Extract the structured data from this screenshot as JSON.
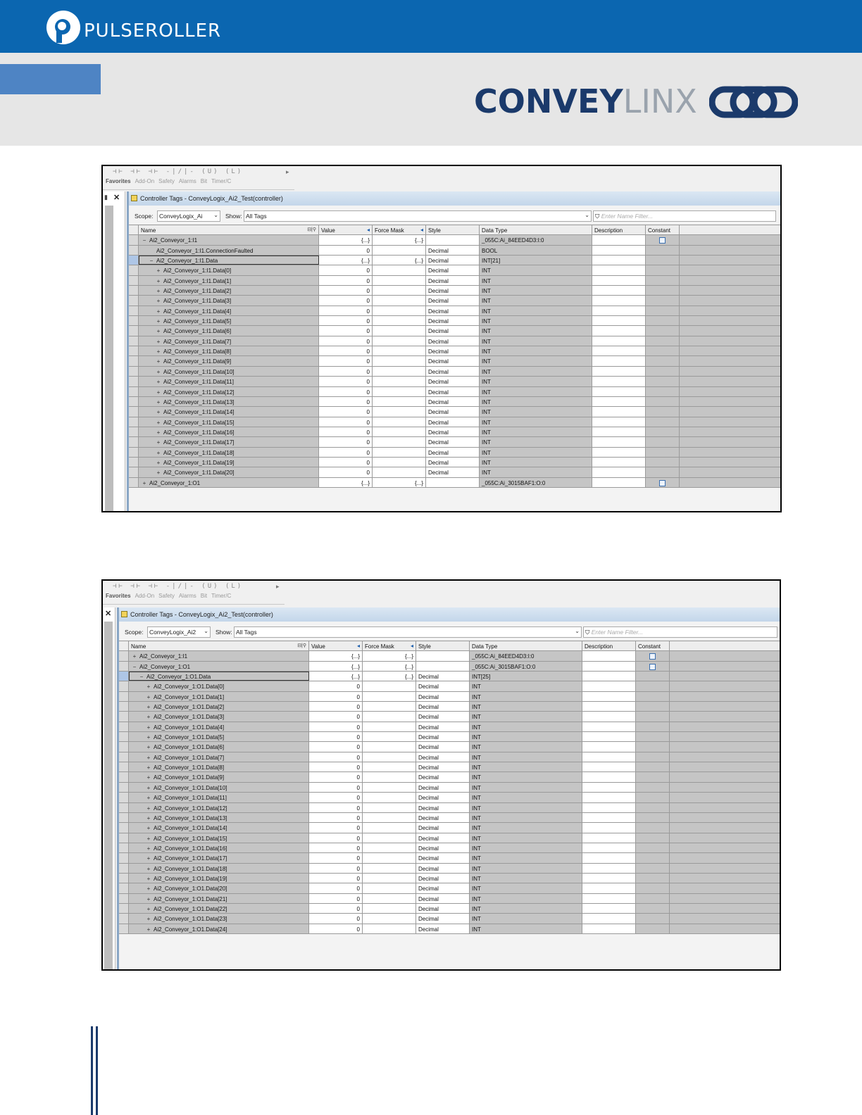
{
  "header": {
    "brand": "PULSEROLLER",
    "product_bold": "CONVEY",
    "product_light": "LINX"
  },
  "colors": {
    "header_blue": "#0b66b0",
    "band_gray": "#e6e6e6",
    "convey_navy": "#1b3a6b",
    "selection_blue": "#aec6e6"
  },
  "toolbar": {
    "tabs": [
      "Favorites",
      "Add-On",
      "Safety",
      "Alarms",
      "Bit",
      "Timer/C"
    ]
  },
  "columns": [
    "Name",
    "Value",
    "Force Mask",
    "Style",
    "Data Type",
    "Description",
    "Constant"
  ],
  "screen1": {
    "window_title": "Controller Tags - ConveyLogix_Ai2_Test(controller)",
    "scope_label": "Scope:",
    "scope_value": "ConveyLogix_Ai",
    "show_label": "Show:",
    "show_value": "All Tags",
    "filter_placeholder": "Enter Name Filter...",
    "rows": [
      {
        "name": "Ai2_Conveyor_1:I1",
        "indent": 0,
        "expander": "−",
        "value": "{...}",
        "force": "{...}",
        "style": "",
        "type": "_055C:Ai_84EED4D3:I:0",
        "constant": true
      },
      {
        "name": "Ai2_Conveyor_1:I1.ConnectionFaulted",
        "indent": 1,
        "expander": "",
        "value": "0",
        "force": "",
        "style": "Decimal",
        "type": "BOOL",
        "constant": false
      },
      {
        "name": "Ai2_Conveyor_1:I1.Data",
        "indent": 1,
        "expander": "−",
        "value": "{...}",
        "force": "{...}",
        "style": "Decimal",
        "type": "INT[21]",
        "constant": false,
        "focus": true
      },
      {
        "name": "Ai2_Conveyor_1:I1.Data[0]",
        "indent": 2,
        "expander": "+",
        "value": "0",
        "force": "",
        "style": "Decimal",
        "type": "INT",
        "constant": false
      },
      {
        "name": "Ai2_Conveyor_1:I1.Data[1]",
        "indent": 2,
        "expander": "+",
        "value": "0",
        "force": "",
        "style": "Decimal",
        "type": "INT",
        "constant": false
      },
      {
        "name": "Ai2_Conveyor_1:I1.Data[2]",
        "indent": 2,
        "expander": "+",
        "value": "0",
        "force": "",
        "style": "Decimal",
        "type": "INT",
        "constant": false
      },
      {
        "name": "Ai2_Conveyor_1:I1.Data[3]",
        "indent": 2,
        "expander": "+",
        "value": "0",
        "force": "",
        "style": "Decimal",
        "type": "INT",
        "constant": false
      },
      {
        "name": "Ai2_Conveyor_1:I1.Data[4]",
        "indent": 2,
        "expander": "+",
        "value": "0",
        "force": "",
        "style": "Decimal",
        "type": "INT",
        "constant": false
      },
      {
        "name": "Ai2_Conveyor_1:I1.Data[5]",
        "indent": 2,
        "expander": "+",
        "value": "0",
        "force": "",
        "style": "Decimal",
        "type": "INT",
        "constant": false
      },
      {
        "name": "Ai2_Conveyor_1:I1.Data[6]",
        "indent": 2,
        "expander": "+",
        "value": "0",
        "force": "",
        "style": "Decimal",
        "type": "INT",
        "constant": false
      },
      {
        "name": "Ai2_Conveyor_1:I1.Data[7]",
        "indent": 2,
        "expander": "+",
        "value": "0",
        "force": "",
        "style": "Decimal",
        "type": "INT",
        "constant": false
      },
      {
        "name": "Ai2_Conveyor_1:I1.Data[8]",
        "indent": 2,
        "expander": "+",
        "value": "0",
        "force": "",
        "style": "Decimal",
        "type": "INT",
        "constant": false
      },
      {
        "name": "Ai2_Conveyor_1:I1.Data[9]",
        "indent": 2,
        "expander": "+",
        "value": "0",
        "force": "",
        "style": "Decimal",
        "type": "INT",
        "constant": false
      },
      {
        "name": "Ai2_Conveyor_1:I1.Data[10]",
        "indent": 2,
        "expander": "+",
        "value": "0",
        "force": "",
        "style": "Decimal",
        "type": "INT",
        "constant": false
      },
      {
        "name": "Ai2_Conveyor_1:I1.Data[11]",
        "indent": 2,
        "expander": "+",
        "value": "0",
        "force": "",
        "style": "Decimal",
        "type": "INT",
        "constant": false
      },
      {
        "name": "Ai2_Conveyor_1:I1.Data[12]",
        "indent": 2,
        "expander": "+",
        "value": "0",
        "force": "",
        "style": "Decimal",
        "type": "INT",
        "constant": false
      },
      {
        "name": "Ai2_Conveyor_1:I1.Data[13]",
        "indent": 2,
        "expander": "+",
        "value": "0",
        "force": "",
        "style": "Decimal",
        "type": "INT",
        "constant": false
      },
      {
        "name": "Ai2_Conveyor_1:I1.Data[14]",
        "indent": 2,
        "expander": "+",
        "value": "0",
        "force": "",
        "style": "Decimal",
        "type": "INT",
        "constant": false
      },
      {
        "name": "Ai2_Conveyor_1:I1.Data[15]",
        "indent": 2,
        "expander": "+",
        "value": "0",
        "force": "",
        "style": "Decimal",
        "type": "INT",
        "constant": false
      },
      {
        "name": "Ai2_Conveyor_1:I1.Data[16]",
        "indent": 2,
        "expander": "+",
        "value": "0",
        "force": "",
        "style": "Decimal",
        "type": "INT",
        "constant": false
      },
      {
        "name": "Ai2_Conveyor_1:I1.Data[17]",
        "indent": 2,
        "expander": "+",
        "value": "0",
        "force": "",
        "style": "Decimal",
        "type": "INT",
        "constant": false
      },
      {
        "name": "Ai2_Conveyor_1:I1.Data[18]",
        "indent": 2,
        "expander": "+",
        "value": "0",
        "force": "",
        "style": "Decimal",
        "type": "INT",
        "constant": false
      },
      {
        "name": "Ai2_Conveyor_1:I1.Data[19]",
        "indent": 2,
        "expander": "+",
        "value": "0",
        "force": "",
        "style": "Decimal",
        "type": "INT",
        "constant": false
      },
      {
        "name": "Ai2_Conveyor_1:I1.Data[20]",
        "indent": 2,
        "expander": "+",
        "value": "0",
        "force": "",
        "style": "Decimal",
        "type": "INT",
        "constant": false
      },
      {
        "name": "Ai2_Conveyor_1:O1",
        "indent": 0,
        "expander": "+",
        "value": "{...}",
        "force": "{...}",
        "style": "",
        "type": "_055C:Ai_3015BAF1:O:0",
        "constant": true
      }
    ]
  },
  "screen2": {
    "window_title": "Controller Tags - ConveyLogix_Ai2_Test(controller)",
    "scope_label": "Scope:",
    "scope_value": "ConveyLogix_Ai2",
    "show_label": "Show:",
    "show_value": "All Tags",
    "filter_placeholder": "Enter Name Filter...",
    "rows": [
      {
        "name": "Ai2_Conveyor_1:I1",
        "indent": 0,
        "expander": "+",
        "value": "{...}",
        "force": "{...}",
        "style": "",
        "type": "_055C:Ai_84EED4D3:I:0",
        "constant": true
      },
      {
        "name": "Ai2_Conveyor_1:O1",
        "indent": 0,
        "expander": "−",
        "value": "{...}",
        "force": "{...}",
        "style": "",
        "type": "_055C:Ai_3015BAF1:O:0",
        "constant": true
      },
      {
        "name": "Ai2_Conveyor_1:O1.Data",
        "indent": 1,
        "expander": "−",
        "value": "{...}",
        "force": "{...}",
        "style": "Decimal",
        "type": "INT[25]",
        "constant": false,
        "focus": true
      },
      {
        "name": "Ai2_Conveyor_1:O1.Data[0]",
        "indent": 2,
        "expander": "+",
        "value": "0",
        "force": "",
        "style": "Decimal",
        "type": "INT",
        "constant": false
      },
      {
        "name": "Ai2_Conveyor_1:O1.Data[1]",
        "indent": 2,
        "expander": "+",
        "value": "0",
        "force": "",
        "style": "Decimal",
        "type": "INT",
        "constant": false
      },
      {
        "name": "Ai2_Conveyor_1:O1.Data[2]",
        "indent": 2,
        "expander": "+",
        "value": "0",
        "force": "",
        "style": "Decimal",
        "type": "INT",
        "constant": false
      },
      {
        "name": "Ai2_Conveyor_1:O1.Data[3]",
        "indent": 2,
        "expander": "+",
        "value": "0",
        "force": "",
        "style": "Decimal",
        "type": "INT",
        "constant": false
      },
      {
        "name": "Ai2_Conveyor_1:O1.Data[4]",
        "indent": 2,
        "expander": "+",
        "value": "0",
        "force": "",
        "style": "Decimal",
        "type": "INT",
        "constant": false
      },
      {
        "name": "Ai2_Conveyor_1:O1.Data[5]",
        "indent": 2,
        "expander": "+",
        "value": "0",
        "force": "",
        "style": "Decimal",
        "type": "INT",
        "constant": false
      },
      {
        "name": "Ai2_Conveyor_1:O1.Data[6]",
        "indent": 2,
        "expander": "+",
        "value": "0",
        "force": "",
        "style": "Decimal",
        "type": "INT",
        "constant": false
      },
      {
        "name": "Ai2_Conveyor_1:O1.Data[7]",
        "indent": 2,
        "expander": "+",
        "value": "0",
        "force": "",
        "style": "Decimal",
        "type": "INT",
        "constant": false
      },
      {
        "name": "Ai2_Conveyor_1:O1.Data[8]",
        "indent": 2,
        "expander": "+",
        "value": "0",
        "force": "",
        "style": "Decimal",
        "type": "INT",
        "constant": false
      },
      {
        "name": "Ai2_Conveyor_1:O1.Data[9]",
        "indent": 2,
        "expander": "+",
        "value": "0",
        "force": "",
        "style": "Decimal",
        "type": "INT",
        "constant": false
      },
      {
        "name": "Ai2_Conveyor_1:O1.Data[10]",
        "indent": 2,
        "expander": "+",
        "value": "0",
        "force": "",
        "style": "Decimal",
        "type": "INT",
        "constant": false
      },
      {
        "name": "Ai2_Conveyor_1:O1.Data[11]",
        "indent": 2,
        "expander": "+",
        "value": "0",
        "force": "",
        "style": "Decimal",
        "type": "INT",
        "constant": false
      },
      {
        "name": "Ai2_Conveyor_1:O1.Data[12]",
        "indent": 2,
        "expander": "+",
        "value": "0",
        "force": "",
        "style": "Decimal",
        "type": "INT",
        "constant": false
      },
      {
        "name": "Ai2_Conveyor_1:O1.Data[13]",
        "indent": 2,
        "expander": "+",
        "value": "0",
        "force": "",
        "style": "Decimal",
        "type": "INT",
        "constant": false
      },
      {
        "name": "Ai2_Conveyor_1:O1.Data[14]",
        "indent": 2,
        "expander": "+",
        "value": "0",
        "force": "",
        "style": "Decimal",
        "type": "INT",
        "constant": false
      },
      {
        "name": "Ai2_Conveyor_1:O1.Data[15]",
        "indent": 2,
        "expander": "+",
        "value": "0",
        "force": "",
        "style": "Decimal",
        "type": "INT",
        "constant": false
      },
      {
        "name": "Ai2_Conveyor_1:O1.Data[16]",
        "indent": 2,
        "expander": "+",
        "value": "0",
        "force": "",
        "style": "Decimal",
        "type": "INT",
        "constant": false
      },
      {
        "name": "Ai2_Conveyor_1:O1.Data[17]",
        "indent": 2,
        "expander": "+",
        "value": "0",
        "force": "",
        "style": "Decimal",
        "type": "INT",
        "constant": false
      },
      {
        "name": "Ai2_Conveyor_1:O1.Data[18]",
        "indent": 2,
        "expander": "+",
        "value": "0",
        "force": "",
        "style": "Decimal",
        "type": "INT",
        "constant": false
      },
      {
        "name": "Ai2_Conveyor_1:O1.Data[19]",
        "indent": 2,
        "expander": "+",
        "value": "0",
        "force": "",
        "style": "Decimal",
        "type": "INT",
        "constant": false
      },
      {
        "name": "Ai2_Conveyor_1:O1.Data[20]",
        "indent": 2,
        "expander": "+",
        "value": "0",
        "force": "",
        "style": "Decimal",
        "type": "INT",
        "constant": false
      },
      {
        "name": "Ai2_Conveyor_1:O1.Data[21]",
        "indent": 2,
        "expander": "+",
        "value": "0",
        "force": "",
        "style": "Decimal",
        "type": "INT",
        "constant": false
      },
      {
        "name": "Ai2_Conveyor_1:O1.Data[22]",
        "indent": 2,
        "expander": "+",
        "value": "0",
        "force": "",
        "style": "Decimal",
        "type": "INT",
        "constant": false
      },
      {
        "name": "Ai2_Conveyor_1:O1.Data[23]",
        "indent": 2,
        "expander": "+",
        "value": "0",
        "force": "",
        "style": "Decimal",
        "type": "INT",
        "constant": false
      },
      {
        "name": "Ai2_Conveyor_1:O1.Data[24]",
        "indent": 2,
        "expander": "+",
        "value": "0",
        "force": "",
        "style": "Decimal",
        "type": "INT",
        "constant": false
      }
    ]
  }
}
